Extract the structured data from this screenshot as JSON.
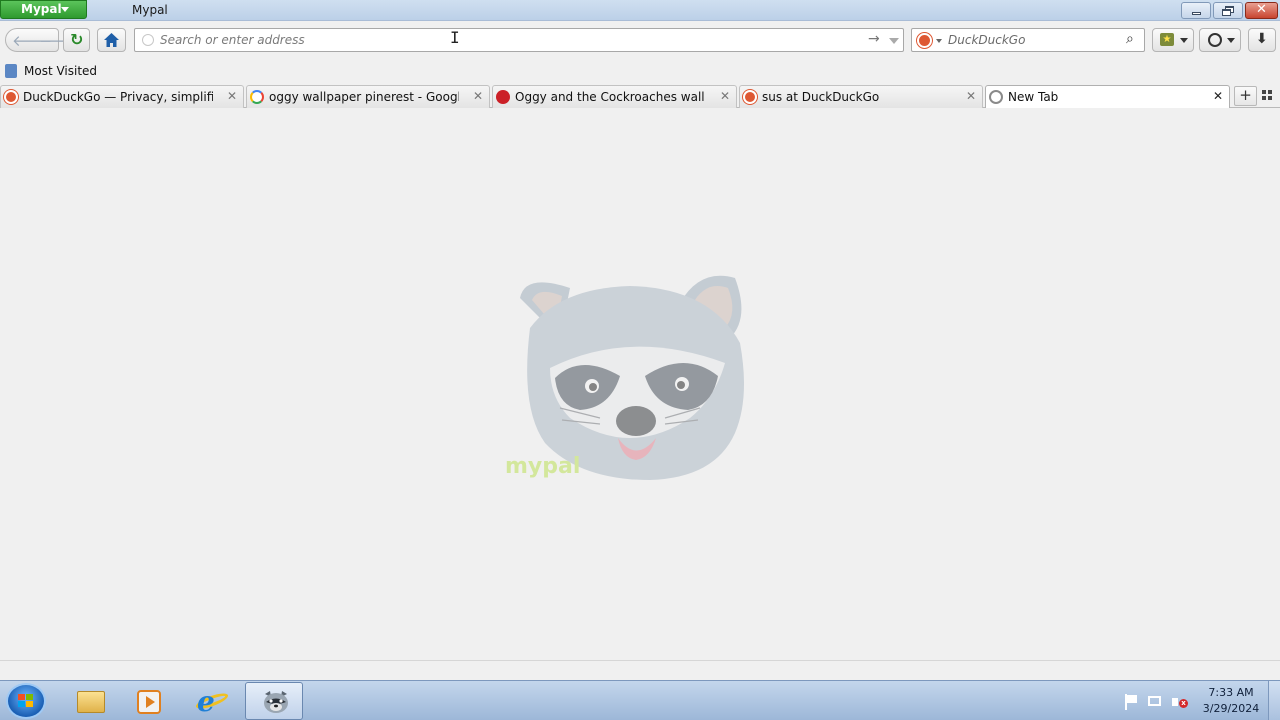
{
  "window": {
    "app_menu_label": "Mypal",
    "title": "Mypal"
  },
  "navbar": {
    "address_placeholder": "Search or enter address",
    "address_value": "",
    "search_engine": "DuckDuckGo",
    "search_placeholder": "DuckDuckGo"
  },
  "bookmarks_bar": {
    "items": [
      {
        "label": "Most Visited",
        "icon": "bookmarks-folder-icon"
      }
    ]
  },
  "tabs": [
    {
      "label": "DuckDuckGo — Privacy, simplified.",
      "favicon": "duckduckgo-icon",
      "active": false
    },
    {
      "label": "oggy wallpaper pinerest - Google Se...",
      "favicon": "google-icon",
      "active": false
    },
    {
      "label": "Oggy and the Cockroaches wallpape...",
      "favicon": "pinterest-icon",
      "active": false
    },
    {
      "label": "sus at DuckDuckGo",
      "favicon": "duckduckgo-icon",
      "active": false
    },
    {
      "label": "New Tab",
      "favicon": "globe-icon",
      "active": true
    }
  ],
  "content": {
    "watermark_text": "mypal",
    "image": "raccoon-mascot"
  },
  "taskbar": {
    "pinned": [
      {
        "name": "windows-explorer",
        "icon": "folder-icon"
      },
      {
        "name": "media-player",
        "icon": "media-player-icon"
      },
      {
        "name": "internet-explorer",
        "icon": "ie-icon"
      },
      {
        "name": "mypal",
        "icon": "raccoon-icon",
        "active": true
      }
    ],
    "clock": {
      "time": "7:33 AM",
      "date": "3/29/2024"
    }
  },
  "colors": {
    "app_menu_green": "#2e9a2e",
    "ddg_orange": "#de5833",
    "pinterest_red": "#cb2027",
    "content_bg": "#f0f0f0"
  }
}
